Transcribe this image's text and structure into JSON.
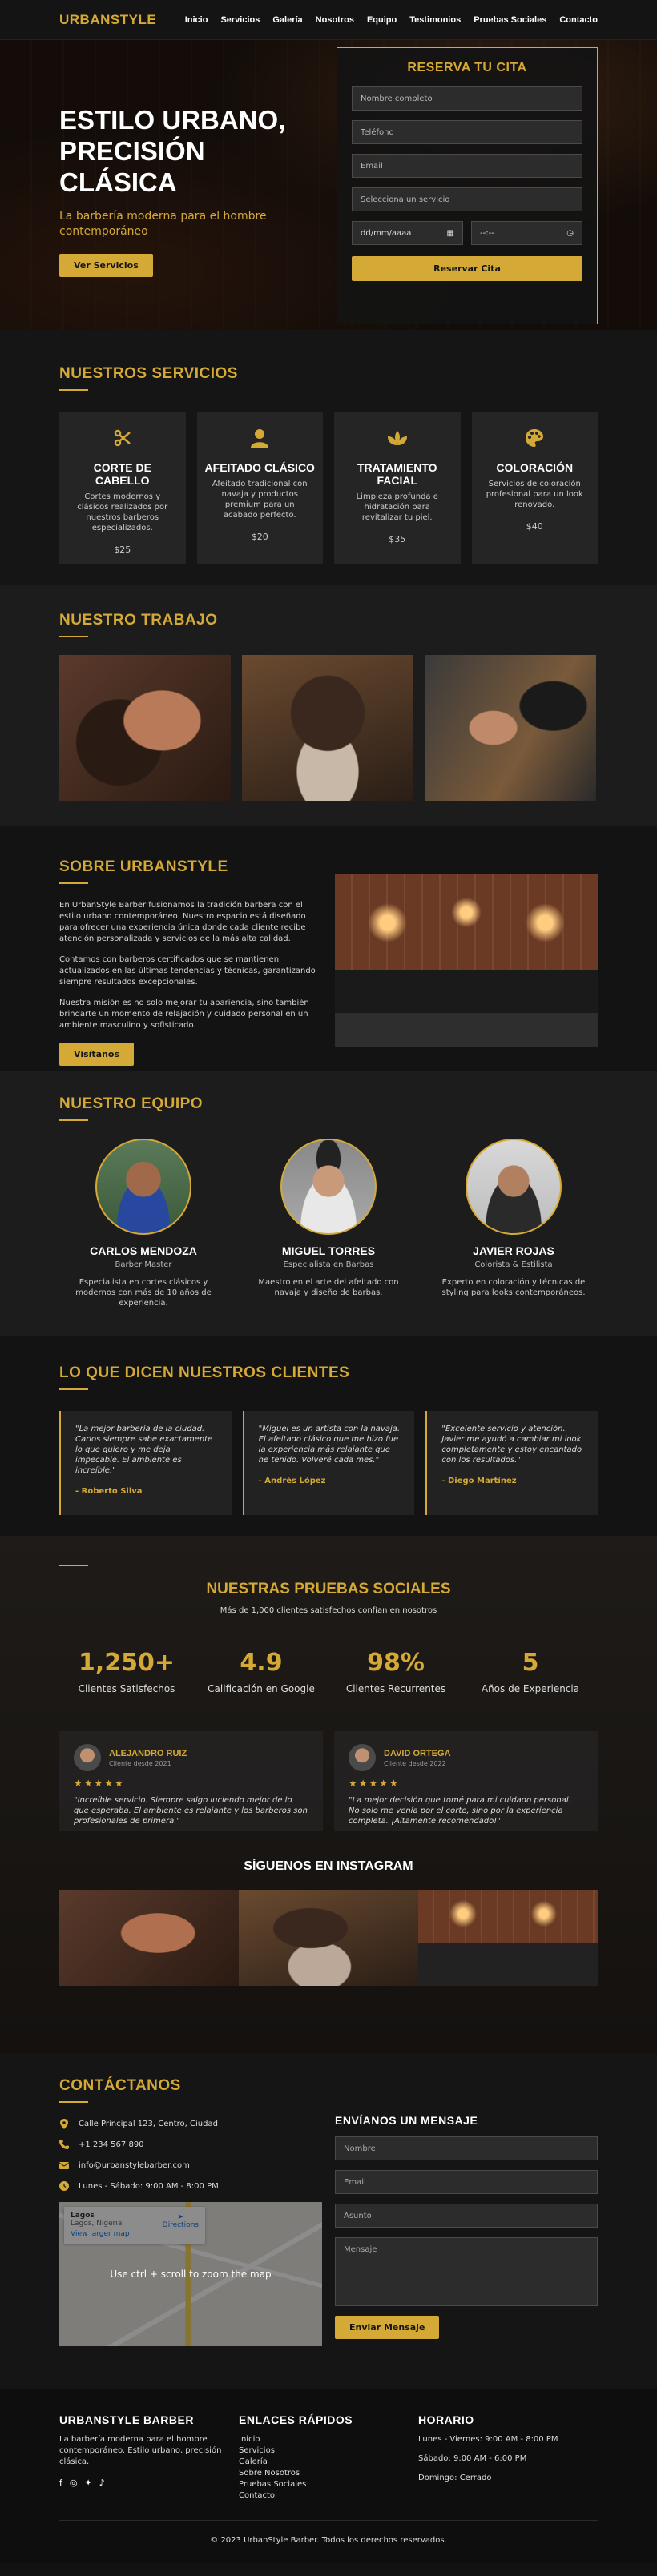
{
  "nav": {
    "logo": "URBANSTYLE",
    "links": [
      "Inicio",
      "Servicios",
      "Galería",
      "Nosotros",
      "Equipo",
      "Testimonios",
      "Pruebas Sociales",
      "Contacto"
    ]
  },
  "hero": {
    "title": "ESTILO URBANO, PRECISIÓN CLÁSICA",
    "subtitle": "La barbería moderna para el hombre contemporáneo",
    "button": "Ver Servicios"
  },
  "booking": {
    "title": "RESERVA TU CITA",
    "name_placeholder": "Nombre completo",
    "phone_placeholder": "Teléfono",
    "email_placeholder": "Email",
    "service_placeholder": "Selecciona un servicio",
    "date_placeholder": "dd/mm/aaaa",
    "time_placeholder": "--:--",
    "submit": "Reservar Cita"
  },
  "services": {
    "title": "NUESTROS SERVICIOS",
    "items": [
      {
        "name": "CORTE DE CABELLO",
        "desc": "Cortes modernos y clásicos realizados por nuestros barberos especializados.",
        "price": "$25",
        "icon": "scissors-icon"
      },
      {
        "name": "AFEITADO CLÁSICO",
        "desc": "Afeitado tradicional con navaja y productos premium para un acabado perfecto.",
        "price": "$20",
        "icon": "user-icon"
      },
      {
        "name": "TRATAMIENTO FACIAL",
        "desc": "Limpieza profunda e hidratación para revitalizar tu piel.",
        "price": "$35",
        "icon": "spa-icon"
      },
      {
        "name": "COLORACIÓN",
        "desc": "Servicios de coloración profesional para un look renovado.",
        "price": "$40",
        "icon": "palette-icon"
      }
    ]
  },
  "gallery": {
    "title": "NUESTRO TRABAJO"
  },
  "about": {
    "title": "SOBRE URBANSTYLE",
    "p1": "En UrbanStyle Barber fusionamos la tradición barbera con el estilo urbano contemporáneo. Nuestro espacio está diseñado para ofrecer una experiencia única donde cada cliente recibe atención personalizada y servicios de la más alta calidad.",
    "p2": "Contamos con barberos certificados que se mantienen actualizados en las últimas tendencias y técnicas, garantizando siempre resultados excepcionales.",
    "p3": "Nuestra misión es no solo mejorar tu apariencia, sino también brindarte un momento de relajación y cuidado personal en un ambiente masculino y sofisticado.",
    "button": "Visítanos"
  },
  "team": {
    "title": "NUESTRO EQUIPO",
    "members": [
      {
        "name": "CARLOS MENDOZA",
        "role": "Barber Master",
        "desc": "Especialista en cortes clásicos y modernos con más de 10 años de experiencia."
      },
      {
        "name": "MIGUEL TORRES",
        "role": "Especialista en Barbas",
        "desc": "Maestro en el arte del afeitado con navaja y diseño de barbas."
      },
      {
        "name": "JAVIER ROJAS",
        "role": "Colorista & Estilista",
        "desc": "Experto en coloración y técnicas de styling para looks contemporáneos."
      }
    ]
  },
  "testimonials": {
    "title": "LO QUE DICEN NUESTROS CLIENTES",
    "items": [
      {
        "text": "\"La mejor barbería de la ciudad. Carlos siempre sabe exactamente lo que quiero y me deja impecable. El ambiente es increíble.\"",
        "author": "- Roberto Silva"
      },
      {
        "text": "\"Miguel es un artista con la navaja. El afeitado clásico que me hizo fue la experiencia más relajante que he tenido. Volveré cada mes.\"",
        "author": "- Andrés López"
      },
      {
        "text": "\"Excelente servicio y atención. Javier me ayudó a cambiar mi look completamente y estoy encantado con los resultados.\"",
        "author": "- Diego Martínez"
      }
    ]
  },
  "social": {
    "title": "NUESTRAS PRUEBAS SOCIALES",
    "subtitle": "Más de 1,000 clientes satisfechos confían en nosotros",
    "stats": [
      {
        "num": "1,250+",
        "label": "Clientes Satisfechos"
      },
      {
        "num": "4.9",
        "label": "Calificación en Google"
      },
      {
        "num": "98%",
        "label": "Clientes Recurrentes"
      },
      {
        "num": "5",
        "label": "Años de Experiencia"
      }
    ],
    "reviews": [
      {
        "name": "ALEJANDRO RUIZ",
        "since": "Cliente desde 2021",
        "stars": "★★★★★",
        "text": "\"Increíble servicio. Siempre salgo luciendo mejor de lo que esperaba. El ambiente es relajante y los barberos son profesionales de primera.\""
      },
      {
        "name": "DAVID ORTEGA",
        "since": "Cliente desde 2022",
        "stars": "★★★★★",
        "text": "\"La mejor decisión que tomé para mi cuidado personal. No solo me venía por el corte, sino por la experiencia completa. ¡Altamente recomendado!\""
      }
    ],
    "instagram_title": "SÍGUENOS EN INSTAGRAM"
  },
  "contact": {
    "title": "CONTÁCTANOS",
    "address": "Calle Principal 123, Centro, Ciudad",
    "phone": "+1 234 567 890",
    "email": "info@urbanstylebarber.com",
    "hours": "Lunes - Sábado: 9:00 AM - 8:00 PM",
    "map_place": "Lagos",
    "map_region": "Lagos, Nigeria",
    "map_link": "View larger map",
    "map_directions": "Directions",
    "map_overlay": "Use ctrl + scroll to zoom the map",
    "form_title": "ENVÍANOS UN MENSAJE",
    "form_name": "Nombre",
    "form_email": "Email",
    "form_subject": "Asunto",
    "form_message": "Mensaje",
    "form_button": "Enviar Mensaje"
  },
  "footer": {
    "brand": "URBANSTYLE BARBER",
    "brand_desc": "La barbería moderna para el hombre contemporáneo. Estilo urbano, precisión clásica.",
    "links_title": "ENLACES RÁPIDOS",
    "links": [
      "Inicio",
      "Servicios",
      "Galería",
      "Sobre Nosotros",
      "Pruebas Sociales",
      "Contacto"
    ],
    "hours_title": "HORARIO",
    "hours": [
      "Lunes - Viernes: 9:00 AM - 8:00 PM",
      "Sábado: 9:00 AM - 6:00 PM",
      "Domingo: Cerrado"
    ],
    "copyright": "© 2023 UrbanStyle Barber. Todos los derechos reservados."
  }
}
